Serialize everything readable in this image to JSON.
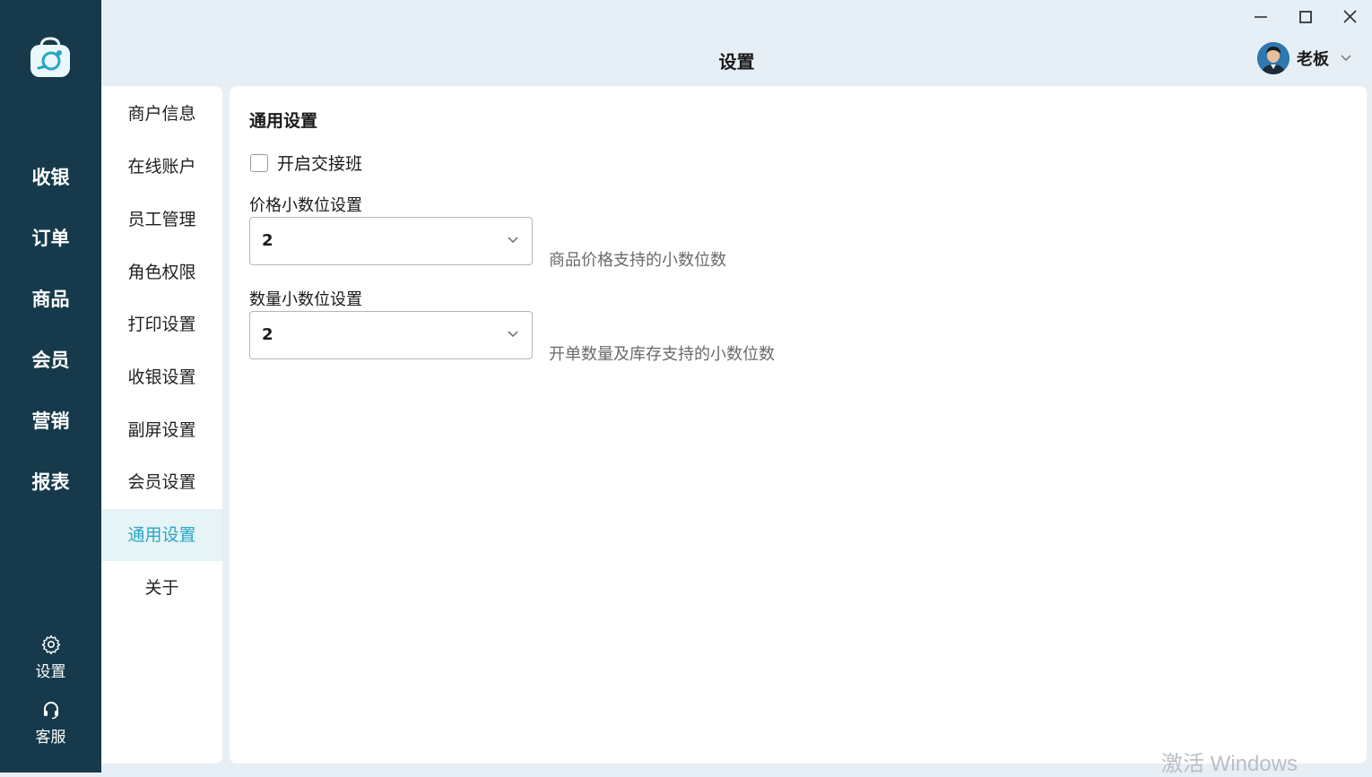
{
  "app": {
    "title": "设置",
    "user_name": "老板",
    "watermark": "激活 Windows"
  },
  "main_nav": {
    "items": [
      {
        "label": "收银"
      },
      {
        "label": "订单"
      },
      {
        "label": "商品"
      },
      {
        "label": "会员"
      },
      {
        "label": "营销"
      },
      {
        "label": "报表"
      }
    ],
    "bottom": [
      {
        "label": "设置",
        "icon": "gear-icon"
      },
      {
        "label": "客服",
        "icon": "headset-icon"
      }
    ]
  },
  "settings_nav": {
    "active": "通用设置",
    "items": [
      {
        "label": "商户信息"
      },
      {
        "label": "在线账户"
      },
      {
        "label": "员工管理"
      },
      {
        "label": "角色权限"
      },
      {
        "label": "打印设置"
      },
      {
        "label": "收银设置"
      },
      {
        "label": "副屏设置"
      },
      {
        "label": "会员设置"
      },
      {
        "label": "通用设置"
      },
      {
        "label": "关于"
      }
    ]
  },
  "general": {
    "section_title": "通用设置",
    "shift_handover": {
      "label": "开启交接班",
      "checked": false
    },
    "price_decimal": {
      "label": "价格小数位设置",
      "value": "2",
      "hint": "商品价格支持的小数位数"
    },
    "qty_decimal": {
      "label": "数量小数位设置",
      "value": "2",
      "hint": "开单数量及库存支持的小数位数"
    }
  },
  "colors": {
    "rail": "#163a4b",
    "accent": "#27a6c4",
    "background": "#e7eff6"
  }
}
